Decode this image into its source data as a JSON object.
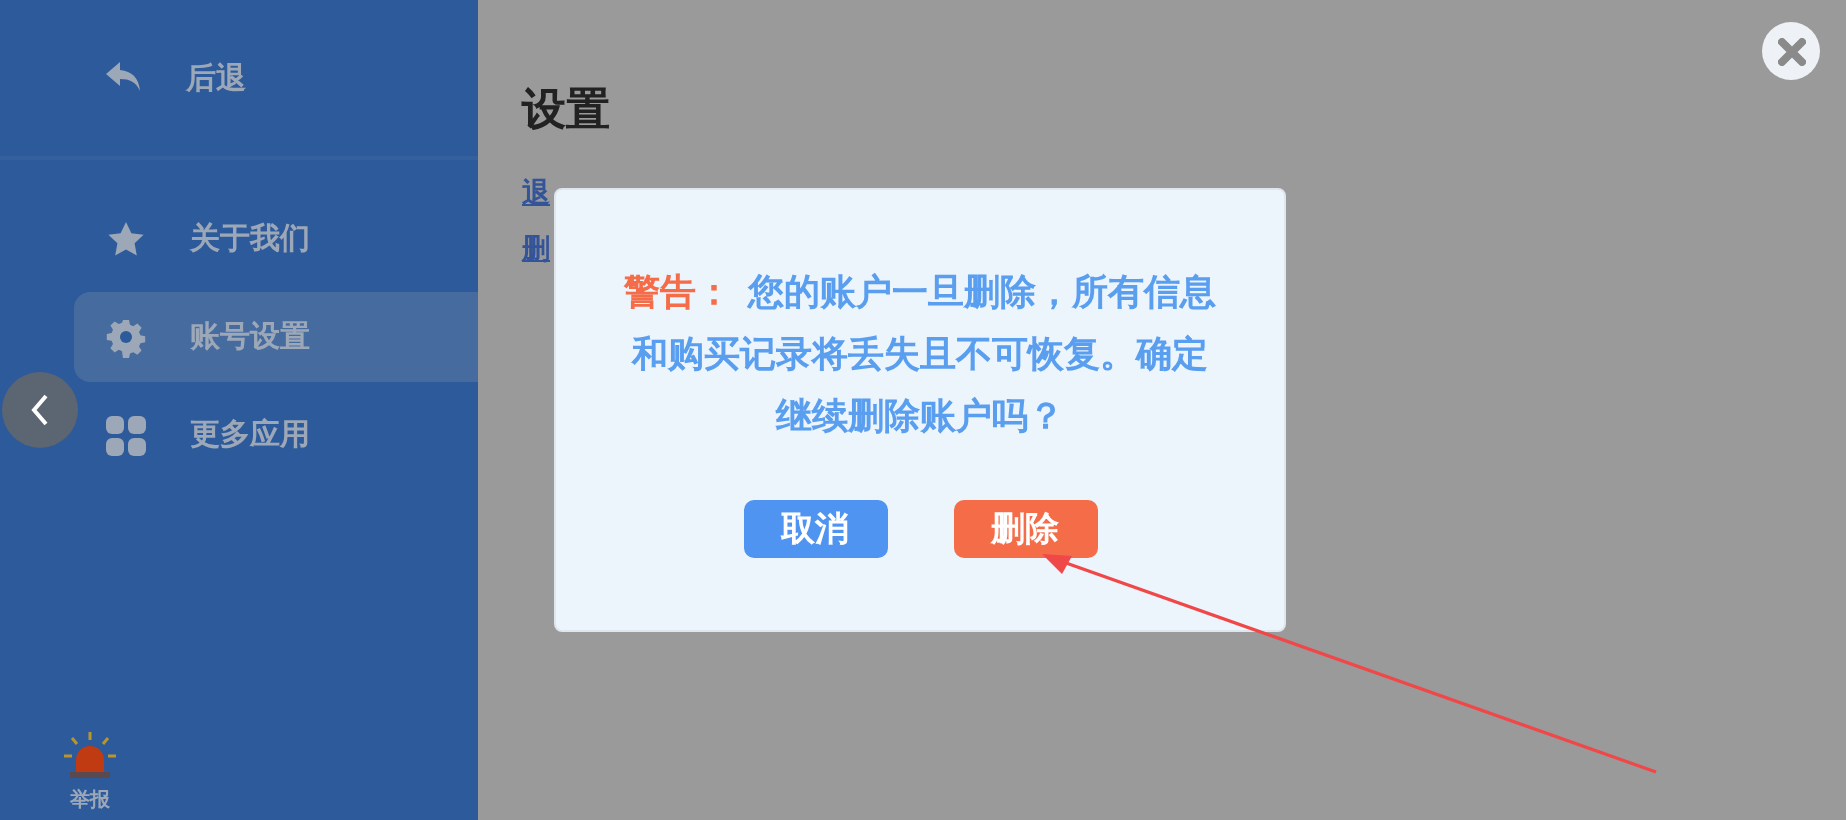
{
  "sidebar": {
    "back": {
      "label": "后退"
    },
    "items": [
      {
        "kind": "star",
        "label": "关于我们",
        "selected": false
      },
      {
        "kind": "gear",
        "label": "账号设置",
        "selected": true
      },
      {
        "kind": "grid",
        "label": "更多应用",
        "selected": false
      }
    ],
    "report": {
      "label": "举报"
    }
  },
  "page": {
    "title": "设置",
    "links": [
      "退",
      "删"
    ]
  },
  "dialog": {
    "warning_label": "警告：",
    "message": "您的账户一旦删除，所有信息和购买记录将丢失且不可恢复。确定继续删除账户吗？",
    "buttons": [
      {
        "kind": "cancel",
        "label": "取消"
      },
      {
        "kind": "danger",
        "label": "删除"
      }
    ]
  }
}
